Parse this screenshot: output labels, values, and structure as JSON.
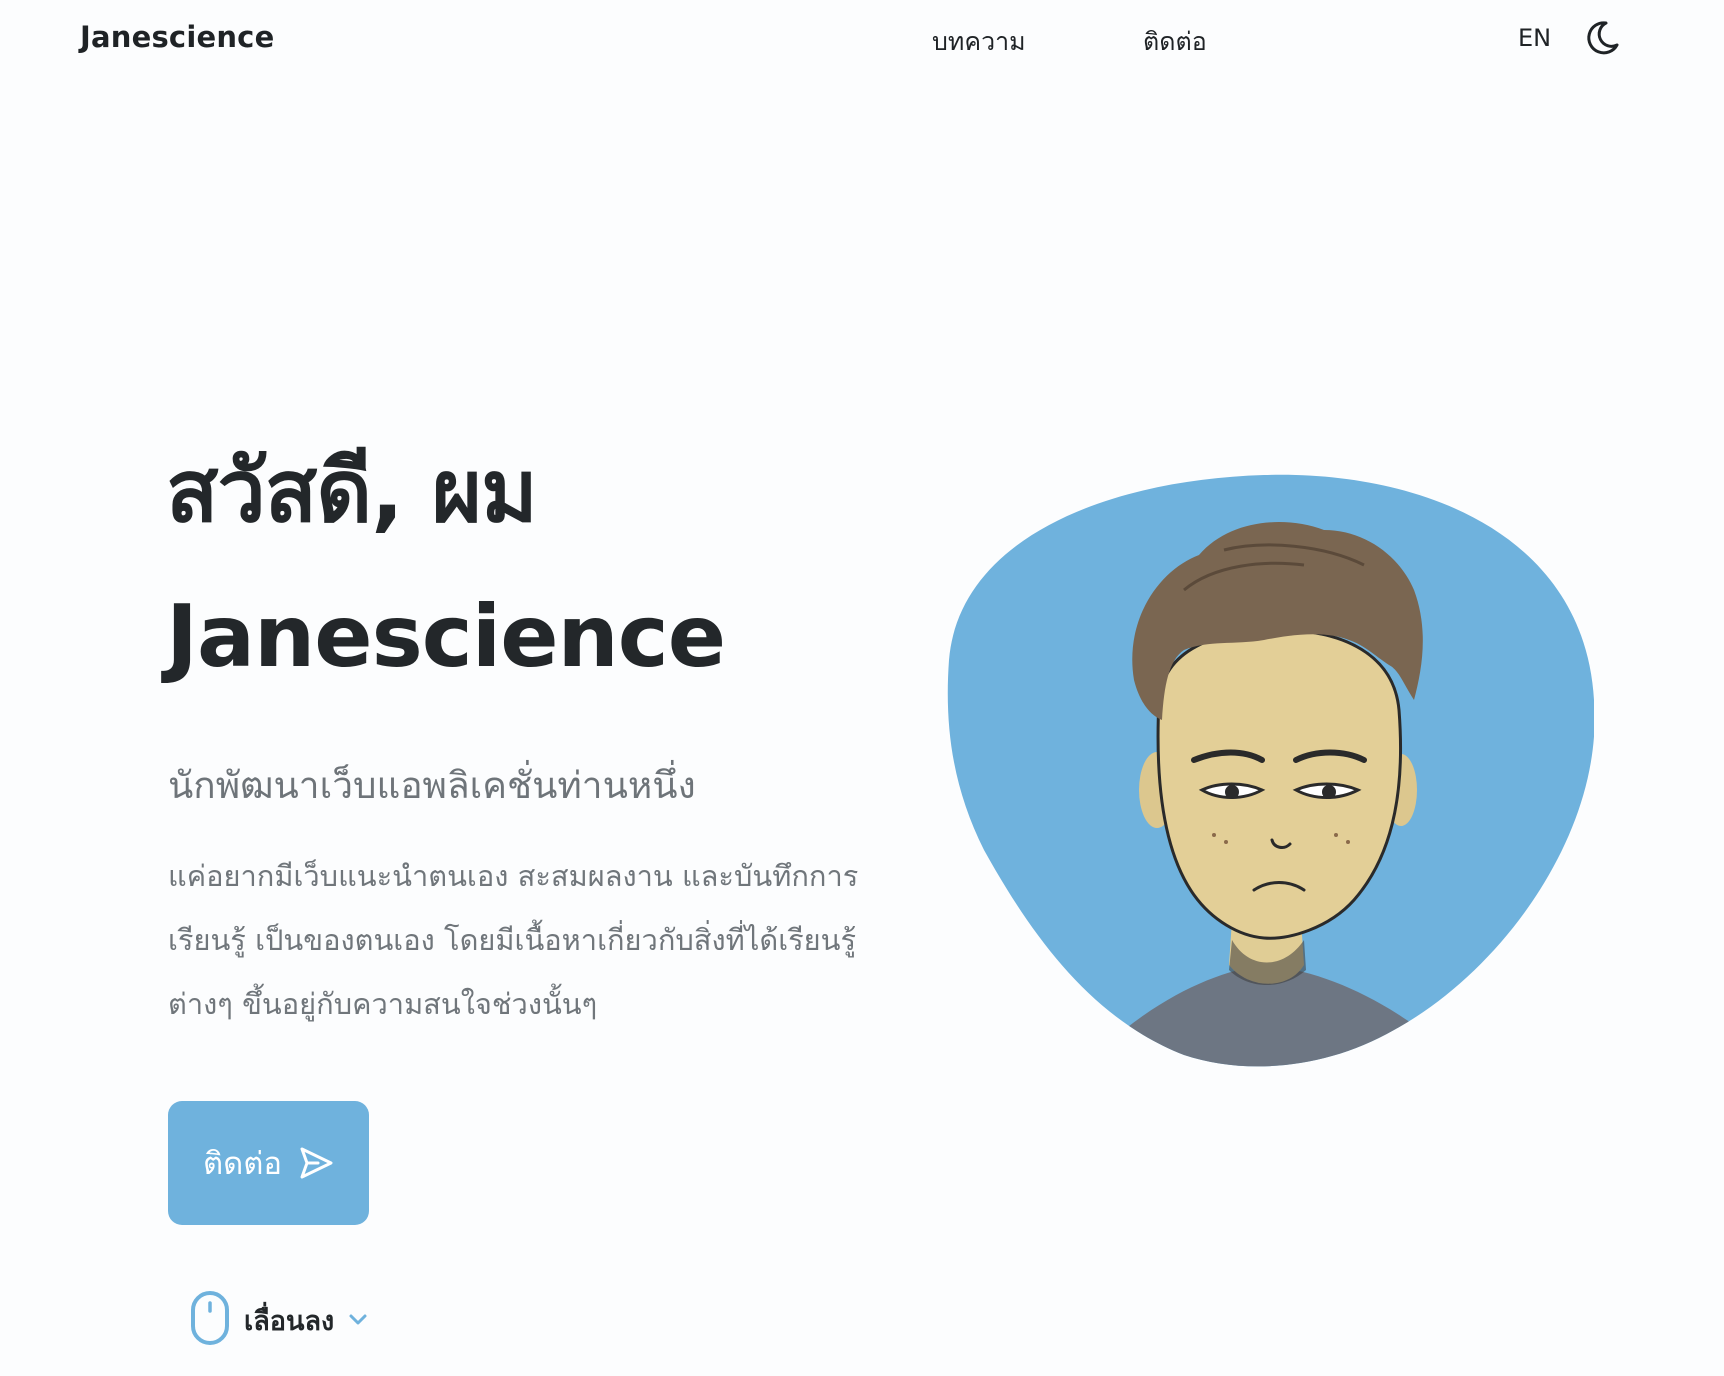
{
  "header": {
    "logo": "Janescience",
    "nav": [
      {
        "label": "บทความ"
      },
      {
        "label": "ติดต่อ"
      }
    ],
    "language": "EN",
    "theme_icon": "moon-icon"
  },
  "hero": {
    "title_line1": "สวัสดี, ผม",
    "title_line2": "Janescience",
    "subtitle": "นักพัฒนาเว็บแอพลิเคชั่นท่านหนึ่ง",
    "description": "แค่อยากมีเว็บแนะนำตนเอง สะสมผลงาน และบันทึกการเรียนรู้ เป็นของตนเอง โดยมีเนื้อหาเกี่ยวกับสิ่งที่ได้เรียนรู้ต่างๆ ขึ้นอยู่กับความสนใจช่วงนั้นๆ",
    "contact_button": "ติดต่อ",
    "contact_icon": "send-icon",
    "scroll_label": "เลื่อนลง",
    "scroll_icon": "mouse-icon",
    "chevron_icon": "chevron-down-icon"
  },
  "colors": {
    "accent": "#6fb2dd",
    "text_dark": "#23272a",
    "text_muted": "#70767b",
    "background": "#fcfdfe"
  }
}
